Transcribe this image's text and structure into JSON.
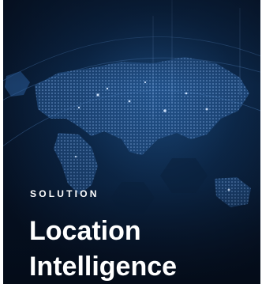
{
  "card": {
    "eyebrow": "SOLUTION",
    "title": "Location Intelligence",
    "background_image": "world-map-lights-image",
    "colors": {
      "background": "#07172b",
      "accent_glow": "#3b7bd4",
      "text": "#ffffff"
    }
  }
}
